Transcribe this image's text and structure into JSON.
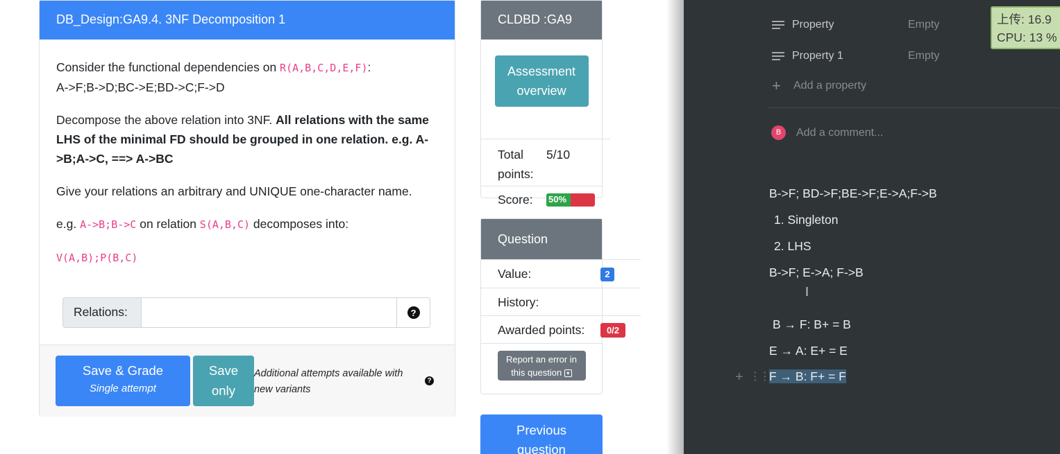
{
  "question": {
    "title": "DB_Design:GA9.4. 3NF Decomposition 1",
    "p1_pre": "Consider the functional dependencies on ",
    "p1_rel": "R(A,B,C,D,E,F)",
    "p1_post": ":",
    "p1_fds": "A->F;B->D;BC->E;BD->C;F->D",
    "p2_pre": "Decompose the above relation into 3NF. ",
    "p2_bold": "All relations with the same LHS of the minimal FD should be grouped in one relation. e.g. A->B;A->C, ==> A->BC",
    "p3": "Give your relations an arbitrary and UNIQUE one-character name.",
    "p4_pre": "e.g. ",
    "p4_fds": "A->B;B->C",
    "p4_mid": " on relation ",
    "p4_rel": "S(A,B,C)",
    "p4_post": " decomposes into:",
    "p5_code": "V(A,B);P(B,C)",
    "relations_label": "Relations:",
    "relations_value": "",
    "grade_button": "Save & Grade",
    "grade_sub": "Single attempt",
    "save_button_l1": "Save",
    "save_button_l2": "only",
    "attempts_note": "Additional attempts available with new variants"
  },
  "assessment": {
    "title": "CLDBD :GA9",
    "overview_l1": "Assessment",
    "overview_l2": "overview",
    "total_label_l1": "Total",
    "total_label_l2": "points:",
    "total_value": "5/10",
    "score_label": "Score:",
    "score_pct": 0.5,
    "score_text": "50%"
  },
  "question_info": {
    "title": "Question",
    "value_label": "Value:",
    "value_badge": "2",
    "history_label": "History:",
    "awarded_label": "Awarded points:",
    "awarded_badge": "0/2",
    "report_l1": "Report an error in",
    "report_l2": "this question",
    "prev_l1": "Previous",
    "prev_l2": "question"
  },
  "notes": {
    "prop1_name": "Property",
    "prop1_value": "Empty",
    "prop2_name": "Property 1",
    "prop2_value": "Empty",
    "add_property": "Add a property",
    "avatar_letter": "B",
    "add_comment": "Add a comment...",
    "line1": "B->F;  BD->F;BE->F;E->A;F->B",
    "item1": "1.  Singleton",
    "item2": "2.  LHS",
    "line2": "B->F; E->A; F->B",
    "line3": "B → F: B+ = B",
    "line4": "E → A: E+ = E",
    "line5": "F → B: F+ = F",
    "overlay_l1": "上传: 16.9",
    "overlay_l2": "CPU: 13 %"
  },
  "colors": {
    "primary": "#3a86f7",
    "info": "#4aa3b0",
    "secondary": "#6c757d",
    "danger": "#dc3545",
    "success": "#2fa34a",
    "code_pink": "#e83e8c",
    "dark_bg": "#2f3437"
  }
}
